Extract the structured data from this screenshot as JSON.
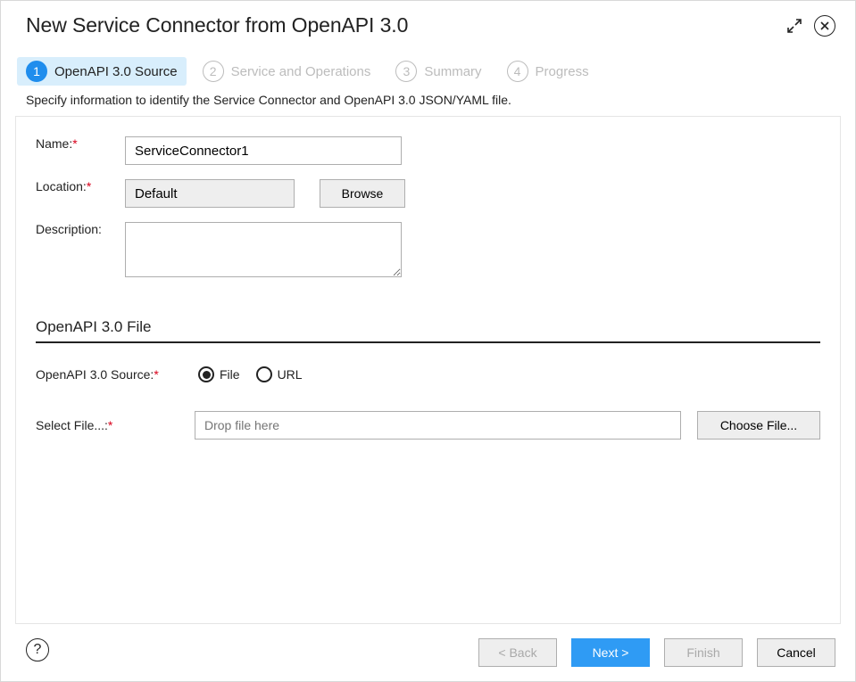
{
  "dialog": {
    "title": "New Service Connector from OpenAPI 3.0"
  },
  "steps": [
    {
      "num": "1",
      "label": "OpenAPI 3.0 Source",
      "state": "active"
    },
    {
      "num": "2",
      "label": "Service and Operations",
      "state": "inactive"
    },
    {
      "num": "3",
      "label": "Summary",
      "state": "inactive"
    },
    {
      "num": "4",
      "label": "Progress",
      "state": "inactive"
    }
  ],
  "subhead": "Specify information to identify the Service Connector and OpenAPI 3.0 JSON/YAML file.",
  "form": {
    "name_label": "Name:",
    "name_value": "ServiceConnector1",
    "location_label": "Location:",
    "location_value": "Default",
    "browse_label": "Browse",
    "description_label": "Description:",
    "description_value": ""
  },
  "section": {
    "heading": "OpenAPI 3.0 File"
  },
  "source": {
    "label": "OpenAPI 3.0 Source:",
    "options": {
      "file": "File",
      "url": "URL"
    },
    "selected": "file"
  },
  "file": {
    "label": "Select File...:",
    "placeholder": "Drop file here",
    "choose_label": "Choose File..."
  },
  "footer": {
    "back": "< Back",
    "next": "Next >",
    "finish": "Finish",
    "cancel": "Cancel"
  }
}
